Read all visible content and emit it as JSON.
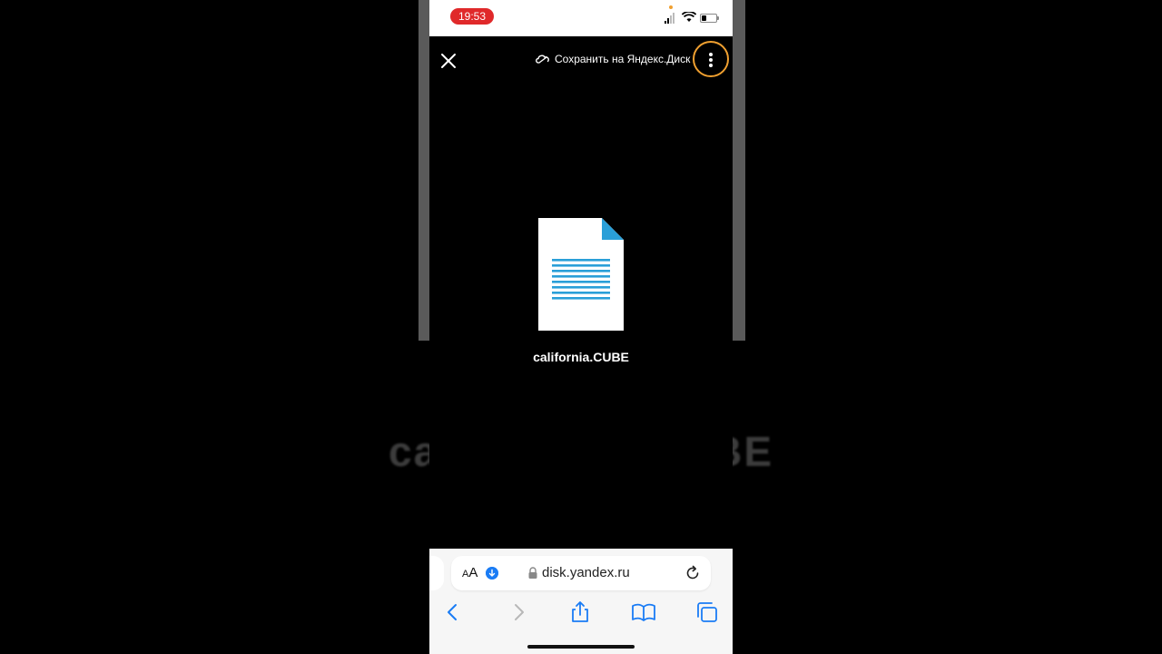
{
  "status_bar": {
    "time": "19:53",
    "time_pill_color": "#e0292a",
    "icons": [
      "cellular-signal-icon",
      "wifi-icon",
      "battery-icon"
    ]
  },
  "viewer": {
    "close_icon": "close-icon",
    "save_label": "Сохранить на Яндекс.Диск",
    "save_icon": "yandex-disk-cloud-icon",
    "menu_icon": "more-vertical-icon",
    "menu_highlight_color": "#f0a030",
    "file_icon": "document-icon",
    "file_icon_color": "#2a9fd8",
    "file_name": "california.CUBE"
  },
  "background": {
    "ghost_text_left": "ca",
    "ghost_text_right": "BE"
  },
  "safari": {
    "text_size_label_small": "A",
    "text_size_label_large": "A",
    "download_icon": "download-arrow-icon",
    "url": "disk.yandex.ru",
    "toolbar": [
      "back-icon",
      "forward-icon",
      "share-icon",
      "bookmarks-icon",
      "tabs-icon"
    ],
    "accent_color": "#1a7cf5"
  }
}
